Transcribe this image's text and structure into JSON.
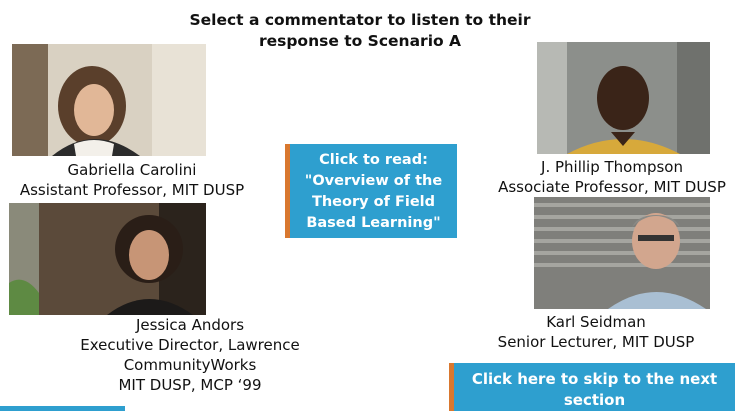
{
  "header": {
    "title_line1": "Select a commentator to listen to their",
    "title_line2": "response to Scenario A"
  },
  "read_button": {
    "line1": "Click to read:",
    "line2": "\"Overview of the",
    "line3": "Theory of Field",
    "line4": "Based Learning\""
  },
  "skip_button": {
    "line1": "Click here to skip to the next",
    "line2": "section"
  },
  "commentators": [
    {
      "name": "Gabriella Carolini",
      "title_line1": "Assistant Professor, MIT DUSP"
    },
    {
      "name": "J. Phillip Thompson",
      "title_line1": "Associate Professor, MIT DUSP"
    },
    {
      "name": "Jessica Andors",
      "title_line1": "Executive Director, Lawrence",
      "title_line2": "CommunityWorks",
      "title_line3": "MIT DUSP, MCP ‘99"
    },
    {
      "name": "Karl Seidman",
      "title_line1": "Senior Lecturer, MIT DUSP"
    }
  ],
  "colors": {
    "button_bg": "#2e9fcf",
    "button_accent": "#d9782f"
  }
}
